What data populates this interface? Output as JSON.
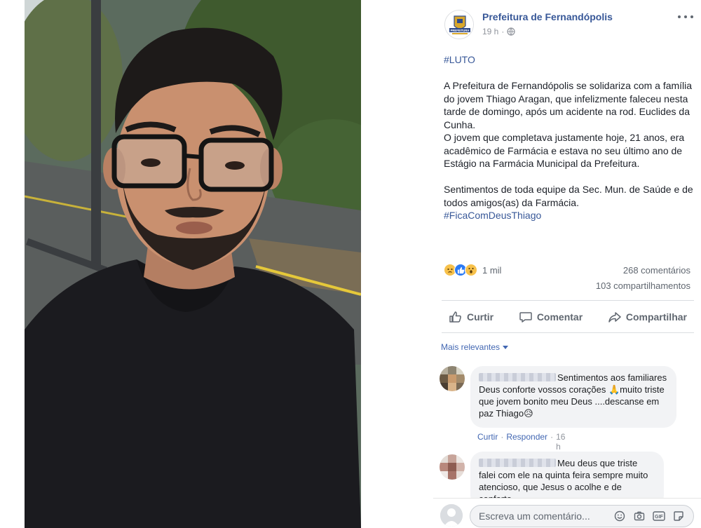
{
  "page": {
    "name": "Prefeitura de Fernandópolis",
    "logo_text": "PREFEITURA",
    "time": "19 h",
    "privacy_icon": "globe-icon"
  },
  "post": {
    "paragraphs": [
      "#LUTO",
      "",
      "A Prefeitura de Fernandópolis se solidariza com a família do jovem Thiago Aragan, que infelizmente faleceu nesta tarde de domingo, após um acidente na rod. Euclides da Cunha.",
      "O jovem que completava justamente hoje, 21 anos, era acadêmico de Farmácia e estava no seu último ano de Estágio na Farmácia Municipal da Prefeitura.",
      "",
      "Sentimentos de toda equipe da Sec. Mun. de Saúde e de todos amigos(as) da Farmácia.",
      "#FicaComDeusThiago"
    ]
  },
  "stats": {
    "reaction_icons": [
      "sad-icon",
      "like-icon",
      "wow-icon"
    ],
    "reactions_count": "1 mil",
    "comments": "268 comentários",
    "shares": "103 compartilhamentos"
  },
  "actions": {
    "like": "Curtir",
    "comment": "Comentar",
    "share": "Compartilhar"
  },
  "comments_section": {
    "sort_label": "Mais relevantes",
    "items": [
      {
        "text": "Sentimentos aos familiares Deus conforte vossos corações 🙏muito triste que jovem bonito meu Deus ....descanse em paz Thiago😥",
        "like": "Curtir",
        "reply": "Responder",
        "time": "16 h"
      },
      {
        "text": "Meu deus que triste falei com ele na quinta feira sempre muito atencioso, que Jesus o acolhe e de conforto",
        "like": "",
        "reply": "",
        "time": ""
      }
    ]
  },
  "composer": {
    "placeholder": "Escreva um comentário...",
    "icons": [
      "emoji-icon",
      "camera-icon",
      "gif-icon",
      "sticker-icon"
    ]
  },
  "colors": {
    "link_blue": "#385898",
    "accent_blue": "#4267b2",
    "muted": "#606770",
    "bubble_bg": "#f2f3f5"
  }
}
